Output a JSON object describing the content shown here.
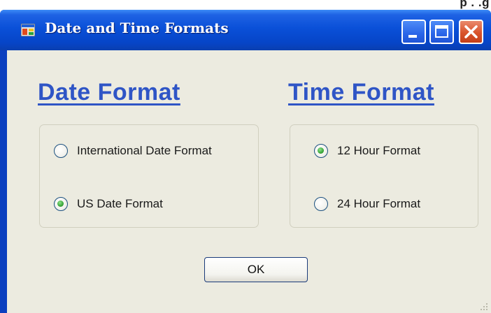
{
  "page": {
    "top_strip_text": "p . .g"
  },
  "window": {
    "title": "Date and Time Formats",
    "controls": {
      "minimize_icon": "minimize-icon",
      "maximize_icon": "maximize-icon",
      "close_icon": "close-icon"
    },
    "colors": {
      "titlebar": "#0a50d8",
      "client_background": "#ecebe0",
      "heading": "#2f55c6",
      "close_button": "#d9532b",
      "radio_checked": "#3aa63a"
    }
  },
  "date_format": {
    "heading": "Date Format",
    "options": [
      {
        "label": "International Date Format",
        "checked": false
      },
      {
        "label": "US Date Format",
        "checked": true
      }
    ]
  },
  "time_format": {
    "heading": "Time Format",
    "options": [
      {
        "label": "12 Hour Format",
        "checked": true
      },
      {
        "label": "24 Hour Format",
        "checked": false
      }
    ]
  },
  "buttons": {
    "ok_label": "OK"
  }
}
